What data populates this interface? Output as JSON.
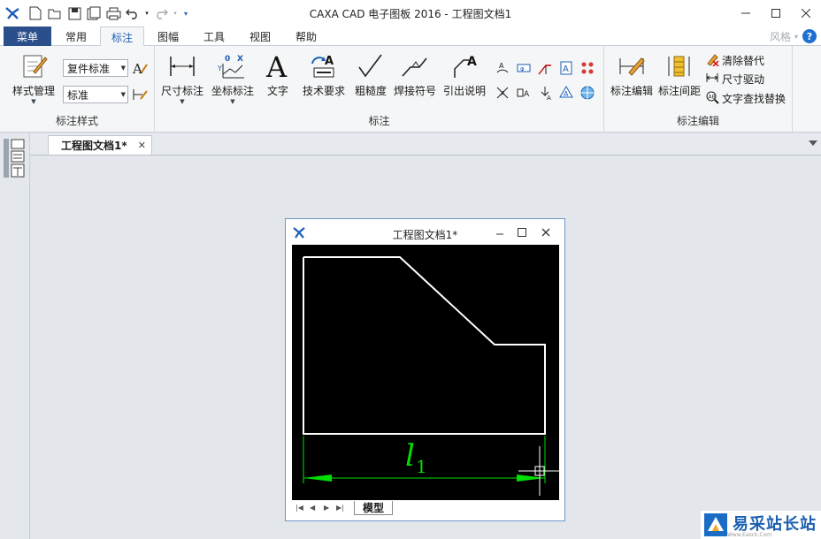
{
  "window": {
    "title": "CAXA CAD 电子图板 2016 - 工程图文档1"
  },
  "ribbon_tabs": {
    "menu": "菜单",
    "tabs": [
      "常用",
      "标注",
      "图幅",
      "工具",
      "视图",
      "帮助"
    ],
    "active_index": 1,
    "style_label": "风格"
  },
  "groups": {
    "style": {
      "label": "标注样式",
      "manage": "样式管理",
      "combo1": "复件标准",
      "combo2": "标准"
    },
    "annotate": {
      "label": "标注",
      "buttons": [
        "尺寸标注",
        "坐标标注",
        "文字",
        "技术要求",
        "粗糙度",
        "焊接符号",
        "引出说明"
      ]
    },
    "edit": {
      "label": "标注编辑",
      "edit_btn": "标注编辑",
      "spacing_btn": "标注间距",
      "clear_override": "清除替代",
      "dim_drive": "尺寸驱动",
      "find_replace": "文字查找替换"
    }
  },
  "document": {
    "tab_label": "工程图文档1*",
    "child_title": "工程图文档1*",
    "layout_tab": "模型",
    "dimension_label": "l",
    "dimension_subscript": "1"
  },
  "watermark": {
    "text": "易采站长站",
    "subtext": "Www.Easck.Com"
  },
  "colors": {
    "menu_bg": "#2b4f8a",
    "canvas_bg": "#000000",
    "geometry": "#ffffff",
    "dimension": "#00e000"
  }
}
